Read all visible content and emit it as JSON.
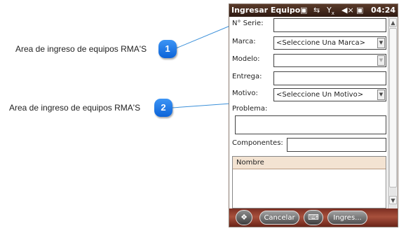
{
  "callouts": [
    {
      "text": "Area de ingreso de equipos RMA'S",
      "number": "1"
    },
    {
      "text": "Area de ingreso de equipos RMA'S",
      "number": "2"
    }
  ],
  "device": {
    "title": "Ingresar Equipo",
    "time": "04:24",
    "status_icons": [
      "notification-icon",
      "sync-icon",
      "signal-off-icon",
      "volume-muted-icon",
      "battery-charging-icon"
    ]
  },
  "form": {
    "serie_label": "N° Serie:",
    "serie_value": "",
    "marca_label": "Marca:",
    "marca_selected": "<Seleccione Una Marca>",
    "modelo_label": "Modelo:",
    "modelo_selected": "",
    "entrega_label": "Entrega:",
    "entrega_value": "",
    "motivo_label": "Motivo:",
    "motivo_selected": "<Seleccione Un Motivo>",
    "problema_label": "Problema:",
    "problema_value": "",
    "componentes_label": "Componentes:",
    "componentes_value": "",
    "grid_header": "Nombre"
  },
  "softbar": {
    "cancel_label": "Cancelar",
    "ingres_label": "Ingres..."
  },
  "colors": {
    "titlebar": "#3d2519",
    "softbar": "#8e3a2c",
    "badge": "#1a73e8",
    "grid_header": "#f3e3d2",
    "leader_line": "#3a8fd9"
  }
}
